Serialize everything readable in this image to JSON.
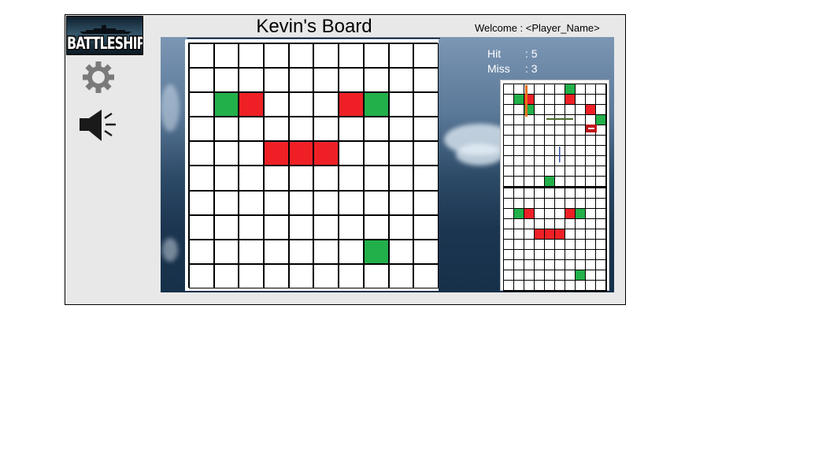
{
  "app": {
    "logo_text": "BATTLESHIP",
    "welcome": "Welcome : <Player_Name>"
  },
  "board": {
    "title": "Kevin's Board",
    "rows": 10,
    "cols": 10,
    "hits": [
      [
        2,
        2
      ],
      [
        2,
        6
      ],
      [
        4,
        3
      ],
      [
        4,
        4
      ],
      [
        4,
        5
      ]
    ],
    "misses": [
      [
        2,
        1
      ],
      [
        2,
        7
      ],
      [
        8,
        7
      ]
    ]
  },
  "stats": {
    "hit_label": "Hit",
    "hit_value": ": 5",
    "miss_label": "Miss",
    "miss_value": ": 3"
  },
  "mini_own_board": {
    "hits": [
      [
        1,
        2
      ],
      [
        1,
        6
      ],
      [
        2,
        8
      ]
    ],
    "misses": [
      [
        0,
        6
      ],
      [
        1,
        1
      ],
      [
        2,
        2
      ],
      [
        3,
        9
      ],
      [
        9,
        4
      ]
    ]
  },
  "mini_target_board": {
    "hits": [
      [
        2,
        2
      ],
      [
        2,
        6
      ],
      [
        4,
        3
      ],
      [
        4,
        4
      ],
      [
        4,
        5
      ]
    ],
    "misses": [
      [
        2,
        1
      ],
      [
        2,
        7
      ],
      [
        8,
        7
      ]
    ]
  },
  "colors": {
    "hit": "#ee2026",
    "miss": "#22b04a",
    "panel": "#e8e8e8"
  },
  "icons": {
    "settings": "gear-icon",
    "sound": "speaker-icon"
  }
}
